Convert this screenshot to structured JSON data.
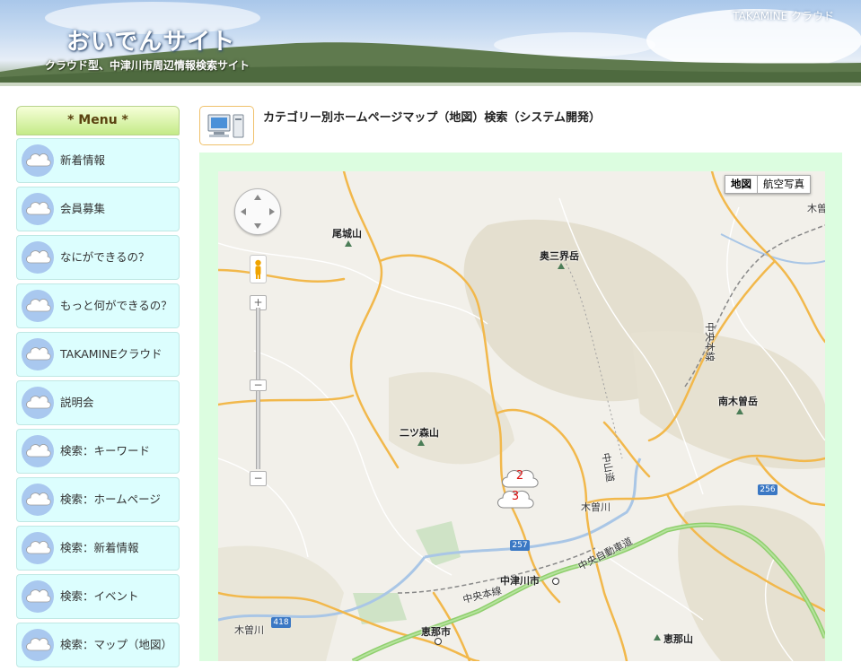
{
  "header": {
    "title": "おいでんサイト",
    "subtitle": "クラウド型、中津川市周辺情報検索サイト",
    "brand": "TAKAMINE クラウド"
  },
  "sidebar": {
    "menu_title": "* Menu *",
    "items": [
      {
        "label": "新着情報"
      },
      {
        "label": "会員募集"
      },
      {
        "label": "なにができるの？"
      },
      {
        "label": "もっと何ができるの？"
      },
      {
        "label": "TAKAMINEクラウド"
      },
      {
        "label": "説明会"
      },
      {
        "label": "検索：キーワード"
      },
      {
        "label": "検索：ホームページ"
      },
      {
        "label": "検索：新着情報"
      },
      {
        "label": "検索：イベント"
      },
      {
        "label": "検索：マップ（地図）"
      }
    ]
  },
  "main": {
    "page_title": "カテゴリー別ホームページマップ（地図）検索（システム開発）",
    "page_icon": "computer-icon"
  },
  "map": {
    "type_buttons": {
      "map": "地図",
      "satellite": "航空写真"
    },
    "zoom_in": "+",
    "zoom_out": "−",
    "places": {
      "obiyama": "尾城山",
      "okusankaidake": "奥三界岳",
      "futatsumoriyama": "二ツ森山",
      "minamikisodake": "南木曽岳",
      "nakatsugawa_city": "中津川市",
      "ena_city": "恵那市",
      "enasan": "恵那山",
      "kisogawa_e": "木曽川",
      "kisogawa_w": "木曽川",
      "kiso_corner": "木曽",
      "chuo_line": "中央本線",
      "chuo_line_e": "中央本線",
      "chuo_expressway": "中央自動車道",
      "nakasendo": "中山道"
    },
    "routes": {
      "r257": "257",
      "r256": "256",
      "r418": "418"
    },
    "markers": [
      {
        "label": "2"
      },
      {
        "label": "3"
      }
    ]
  },
  "colors": {
    "menu_item_bg": "#dcfefe",
    "map_panel_bg": "#dcfde0",
    "road": "#f2b84b",
    "expressway": "#8fcf6d"
  }
}
